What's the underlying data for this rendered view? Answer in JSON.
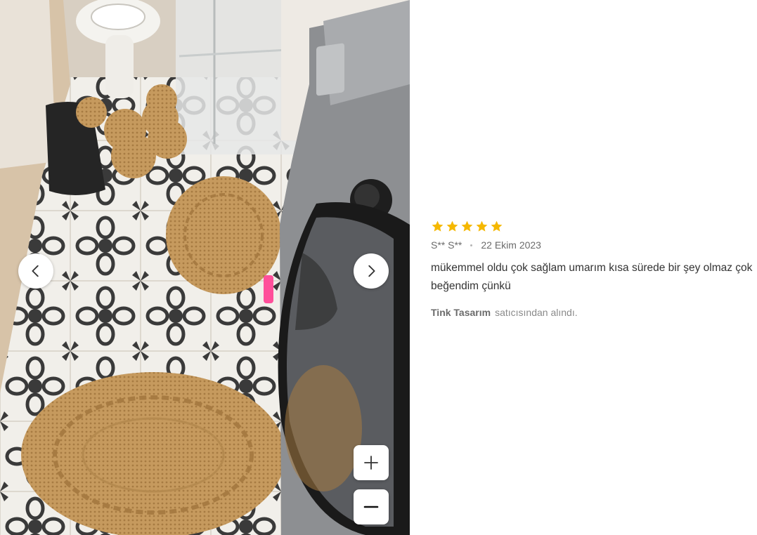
{
  "review": {
    "rating": 5,
    "author": "S** S**",
    "date": "22 Ekim 2023",
    "comment": "mükemmel oldu çok sağlam umarım kısa sürede bir şey olmaz çok beğendim çünkü",
    "seller_name": "Tink Tasarım",
    "seller_suffix": "satıcısından alındı."
  },
  "colors": {
    "star": "#f5b800",
    "rug": "#c69a5e"
  },
  "icons": {
    "prev": "chevron-left-icon",
    "next": "chevron-right-icon",
    "zoom_in": "plus-icon",
    "zoom_out": "minus-icon"
  }
}
